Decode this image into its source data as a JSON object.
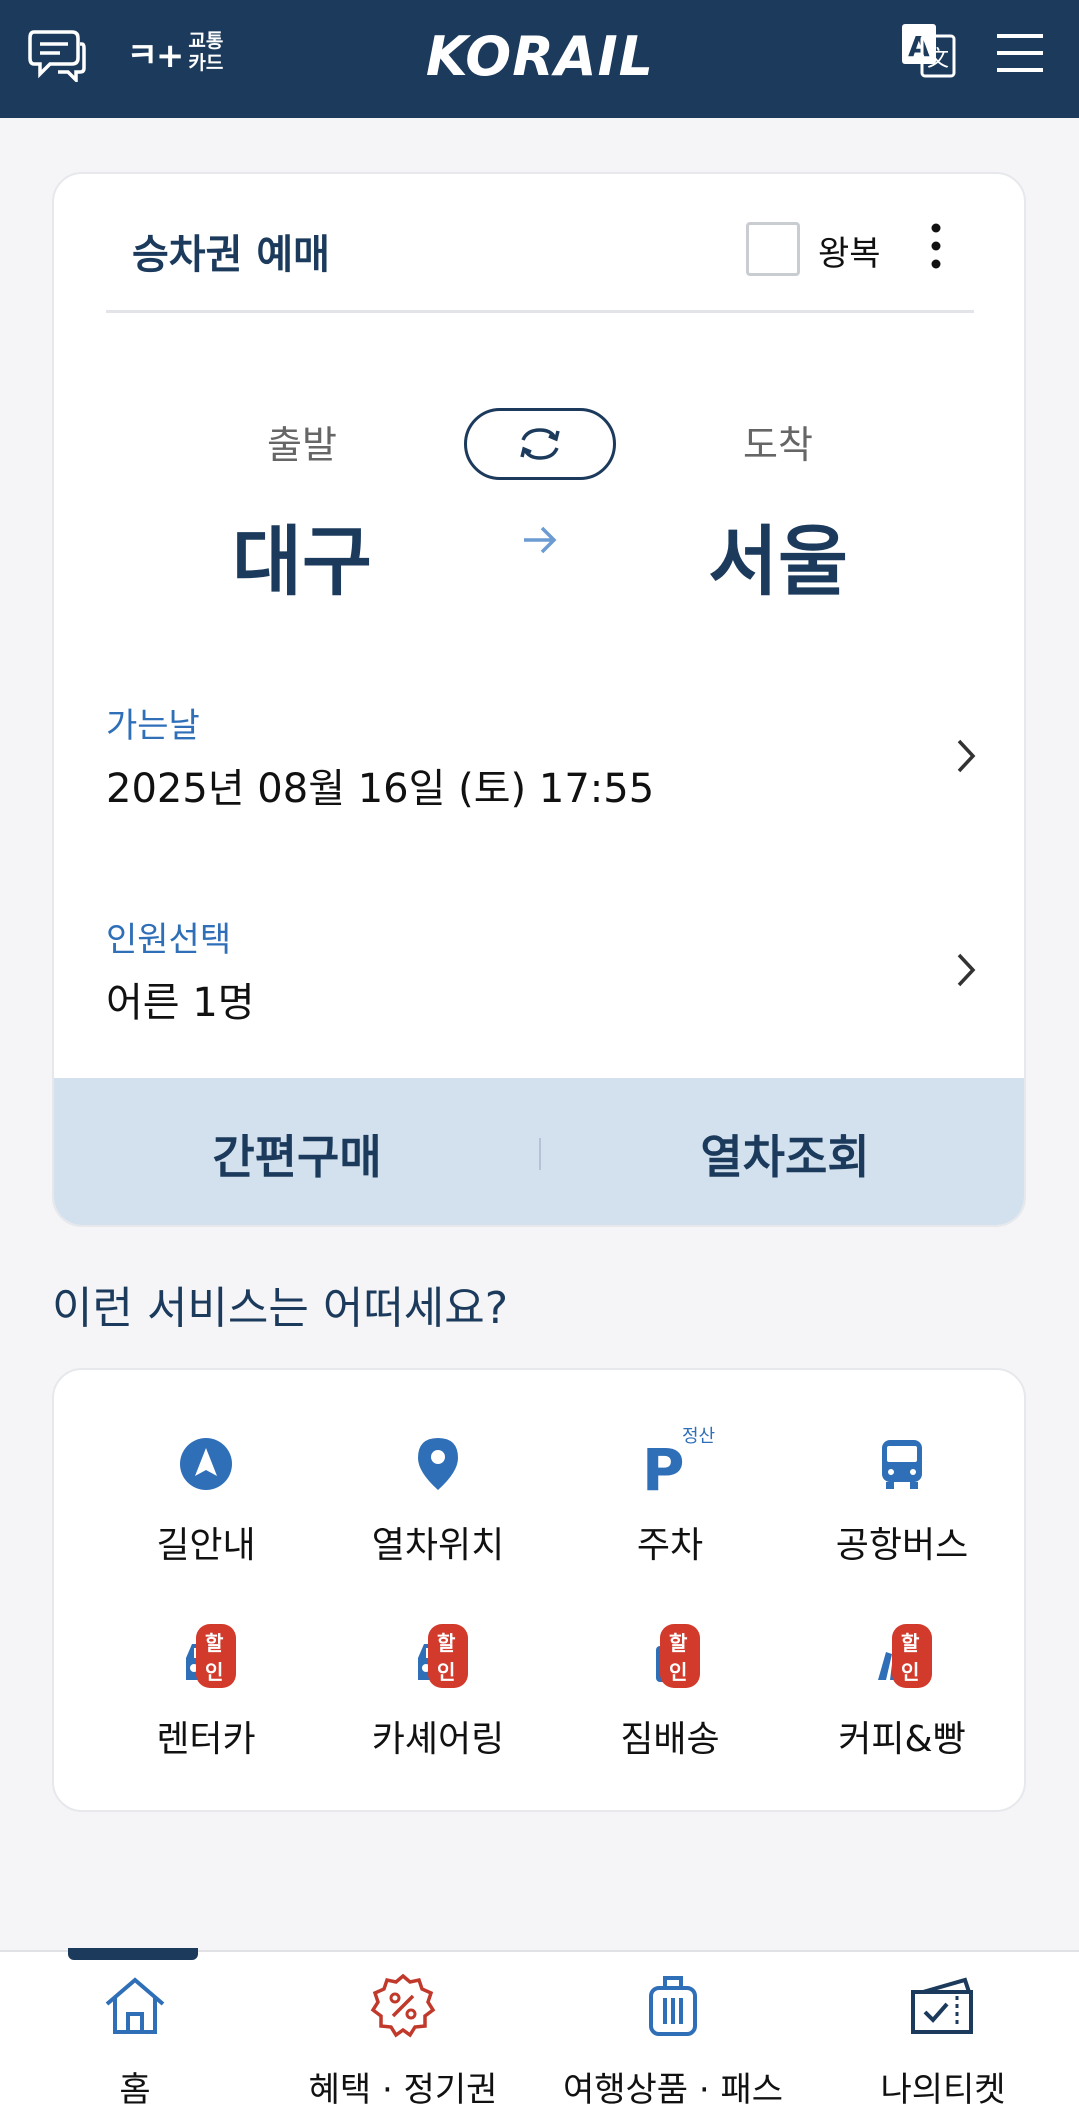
{
  "header": {
    "brand": "KORAIL",
    "transit_card": {
      "mark": "ㅋ+",
      "line1": "교통",
      "line2": "카드"
    },
    "icons": {
      "chat": "chat-icon",
      "translate": "translate-icon",
      "menu": "hamburger-menu-icon"
    },
    "colors": {
      "bg": "#1b3a5c"
    }
  },
  "booking": {
    "title": "승차권 예매",
    "round_trip_label": "왕복",
    "round_trip_checked": false,
    "departure_label": "출발",
    "arrival_label": "도착",
    "departure": "대구",
    "arrival": "서울",
    "date_label": "가는날",
    "date_value": "2025년 08월 16일 (토) 17:55",
    "passenger_label": "인원선택",
    "passenger_value": "어른 1명",
    "quick_buy": "간편구매",
    "search_trains": "열차조회"
  },
  "services": {
    "title": "이런 서비스는 어떠세요?",
    "sale_badge": "할인",
    "parking_super": "정산",
    "items": [
      {
        "label": "길안내",
        "icon": "navigation-icon",
        "sale": false
      },
      {
        "label": "열차위치",
        "icon": "location-pin-icon",
        "sale": false
      },
      {
        "label": "주차",
        "icon": "parking-icon",
        "sale": false
      },
      {
        "label": "공항버스",
        "icon": "bus-icon",
        "sale": false
      },
      {
        "label": "렌터카",
        "icon": "car-icon",
        "sale": true
      },
      {
        "label": "카셰어링",
        "icon": "car-share-icon",
        "sale": true
      },
      {
        "label": "짐배송",
        "icon": "luggage-icon",
        "sale": true
      },
      {
        "label": "커피&빵",
        "icon": "coffee-bread-icon",
        "sale": true
      }
    ]
  },
  "bottom_nav": {
    "items": [
      {
        "label": "홈",
        "icon": "home-icon",
        "active": true
      },
      {
        "label": "혜택 · 정기권",
        "icon": "discount-badge-icon",
        "active": false
      },
      {
        "label": "여행상품 · 패스",
        "icon": "suitcase-icon",
        "active": false
      },
      {
        "label": "나의티켓",
        "icon": "my-ticket-icon",
        "active": false
      }
    ]
  },
  "colors": {
    "primary": "#1b3a5c",
    "accent_blue": "#2f6fb8",
    "sale_red": "#d23a2c",
    "action_bar": "#d3e1ee"
  }
}
